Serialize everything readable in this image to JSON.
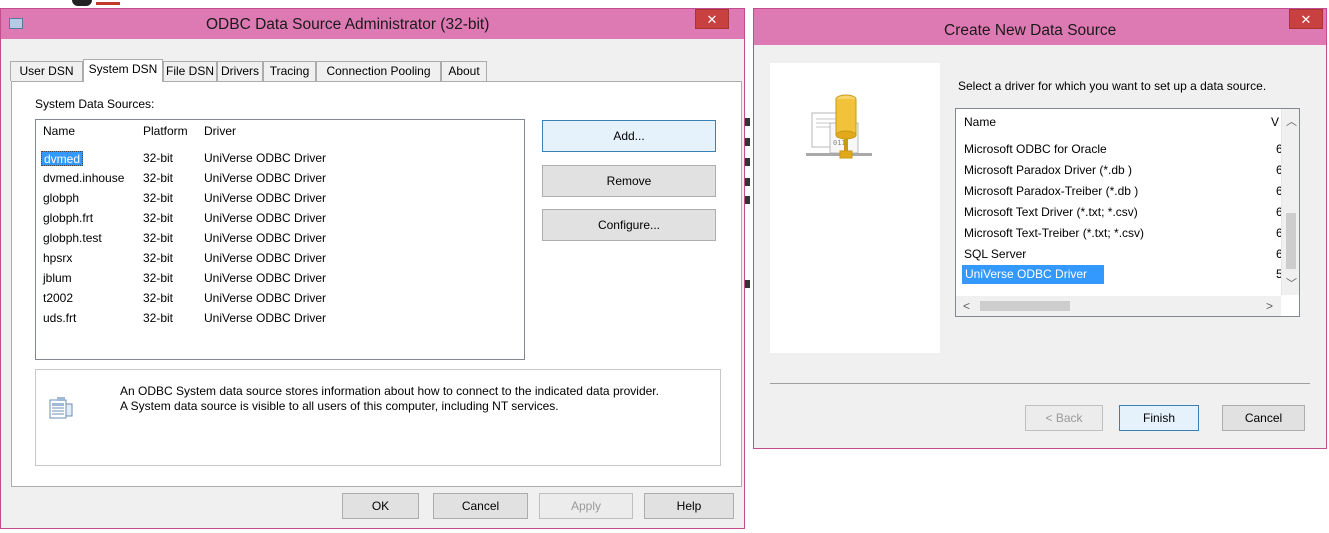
{
  "odbc": {
    "title": "ODBC Data Source Administrator (32-bit)",
    "close_glyph": "✕",
    "tabs": [
      {
        "label": "User DSN"
      },
      {
        "label": "System DSN"
      },
      {
        "label": "File DSN"
      },
      {
        "label": "Drivers"
      },
      {
        "label": "Tracing"
      },
      {
        "label": "Connection Pooling"
      },
      {
        "label": "About"
      }
    ],
    "active_tab": "System DSN",
    "group_label": "System Data Sources:",
    "columns": {
      "name": "Name",
      "platform": "Platform",
      "driver": "Driver"
    },
    "rows": [
      {
        "name": "dvmed",
        "platform": "32-bit",
        "driver": "UniVerse ODBC Driver"
      },
      {
        "name": "dvmed.inhouse",
        "platform": "32-bit",
        "driver": "UniVerse ODBC Driver"
      },
      {
        "name": "globph",
        "platform": "32-bit",
        "driver": "UniVerse ODBC Driver"
      },
      {
        "name": "globph.frt",
        "platform": "32-bit",
        "driver": "UniVerse ODBC Driver"
      },
      {
        "name": "globph.test",
        "platform": "32-bit",
        "driver": "UniVerse ODBC Driver"
      },
      {
        "name": "hpsrx",
        "platform": "32-bit",
        "driver": "UniVerse ODBC Driver"
      },
      {
        "name": "jblum",
        "platform": "32-bit",
        "driver": "UniVerse ODBC Driver"
      },
      {
        "name": "t2002",
        "platform": "32-bit",
        "driver": "UniVerse ODBC Driver"
      },
      {
        "name": "uds.frt",
        "platform": "32-bit",
        "driver": "UniVerse ODBC Driver"
      }
    ],
    "buttons": {
      "add": "Add...",
      "remove": "Remove",
      "configure": "Configure..."
    },
    "info_line1": "An ODBC System data source stores information about how to connect to the indicated data provider.",
    "info_line2": "A System data source is visible to all users of this computer, including NT services.",
    "footer": {
      "ok": "OK",
      "cancel": "Cancel",
      "apply": "Apply",
      "help": "Help"
    }
  },
  "cnds": {
    "title": "Create New Data Source",
    "close_glyph": "✕",
    "prompt": "Select a driver for which you want to set up a data source.",
    "columns": {
      "name": "Name",
      "version": "V"
    },
    "drivers": [
      {
        "name": "Microsoft ODBC for Oracle",
        "version": "6"
      },
      {
        "name": "Microsoft Paradox Driver (*.db )",
        "version": "6"
      },
      {
        "name": "Microsoft Paradox-Treiber (*.db )",
        "version": "6"
      },
      {
        "name": "Microsoft Text Driver (*.txt; *.csv)",
        "version": "6"
      },
      {
        "name": "Microsoft Text-Treiber (*.txt; *.csv)",
        "version": "6"
      },
      {
        "name": "SQL Server",
        "version": "6"
      },
      {
        "name": "UniVerse ODBC Driver",
        "version": "5"
      }
    ],
    "selected_driver": "UniVerse ODBC Driver",
    "buttons": {
      "back": "< Back",
      "finish": "Finish",
      "cancel": "Cancel"
    },
    "art_label": "011"
  },
  "icons": [
    "app-window-icon",
    "close-icon",
    "info-document-icon",
    "database-driver-icon",
    "scroll-up-icon",
    "scroll-down-icon",
    "scroll-left-icon",
    "scroll-right-icon"
  ],
  "colors": {
    "titlebar": "#de7ab3",
    "close": "#c8403f",
    "selection": "#3399ff"
  }
}
